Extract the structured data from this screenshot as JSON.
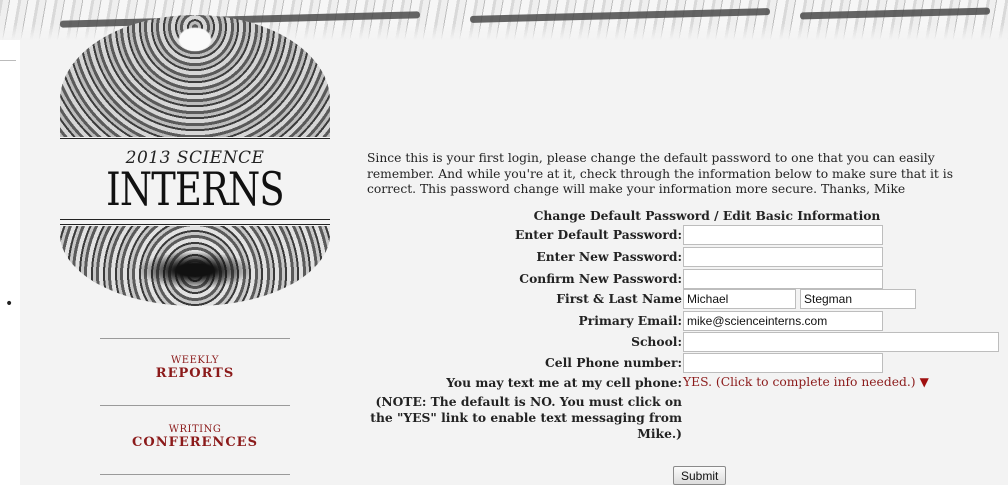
{
  "logo": {
    "year_line": "2013 SCIENCE",
    "word": "INTERNS"
  },
  "nav": {
    "items": [
      {
        "small": "WEEKLY",
        "big": "REPORTS"
      },
      {
        "small": "WRITING",
        "big": "CONFERENCES"
      }
    ]
  },
  "intro_text": "Since this is your first login, please change the default password to one that you can easily remember. And while you're at it, check through the information below to make sure that it is correct. This password change will make your information more secure. Thanks, Mike",
  "form": {
    "title": "Change Default Password / Edit Basic Information",
    "labels": {
      "default_password": "Enter Default Password:",
      "new_password": "Enter New Password:",
      "confirm_password": "Confirm New Password:",
      "name": "First & Last Name",
      "email": "Primary Email:",
      "school": "School:",
      "cell": "Cell Phone number:",
      "text_me": "You may text me at my cell phone:"
    },
    "values": {
      "default_password": "",
      "new_password": "",
      "confirm_password": "",
      "first_name": "Michael",
      "last_name": "Stegman",
      "email": "mike@scienceinterns.com",
      "school": "",
      "cell": ""
    },
    "text_option": "YES. (Click to complete info needed.)",
    "text_option_caret": "▼",
    "note": "(NOTE: The default is NO. You must click on the \"YES\" link to enable text messaging from Mike.)",
    "submit_label": "Submit"
  },
  "colors": {
    "accent": "#8b1a1a",
    "background": "#f3f3f3"
  }
}
